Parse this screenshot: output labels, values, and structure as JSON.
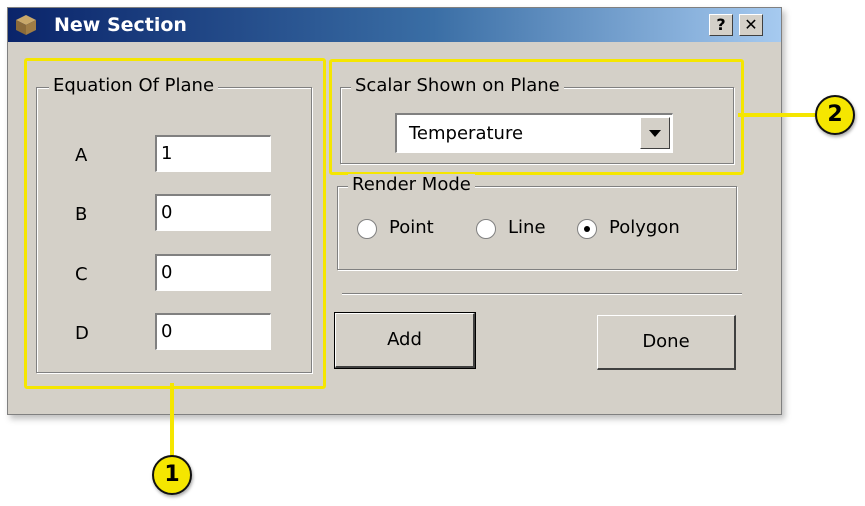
{
  "window": {
    "title": "New Section",
    "help_label": "?",
    "close_label": "✕"
  },
  "equation": {
    "title": "Equation Of Plane",
    "rows": [
      {
        "label": "A",
        "value": "1"
      },
      {
        "label": "B",
        "value": "0"
      },
      {
        "label": "C",
        "value": "0"
      },
      {
        "label": "D",
        "value": "0"
      }
    ]
  },
  "scalar": {
    "title": "Scalar Shown on Plane",
    "selected": "Temperature"
  },
  "render_mode": {
    "title": "Render Mode",
    "options": [
      "Point",
      "Line",
      "Polygon"
    ],
    "selected": "Polygon"
  },
  "buttons": {
    "add": "Add",
    "done": "Done"
  },
  "callouts": [
    "1",
    "2"
  ],
  "colors": {
    "highlight": "#f5e600",
    "titlebar": "#0a246a",
    "dialog": "#d4d0c8"
  }
}
